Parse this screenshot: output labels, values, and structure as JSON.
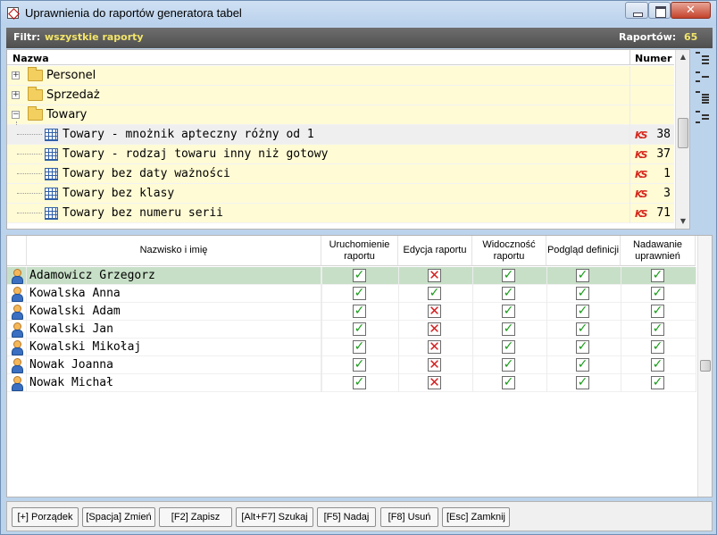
{
  "window": {
    "title": "Uprawnienia do raportów generatora tabel",
    "close_glyph": "✕"
  },
  "filter": {
    "label": "Filtr:",
    "value": "wszystkie raporty",
    "count_label": "Raportów:",
    "count_value": "65"
  },
  "reports": {
    "col_name": "Nazwa",
    "col_number": "Numer",
    "folders": [
      {
        "label": "Personel",
        "expander": "+"
      },
      {
        "label": "Sprzedaż",
        "expander": "+"
      },
      {
        "label": "Towary",
        "expander": "−"
      }
    ],
    "items": [
      {
        "label": "Towary - mnożnik apteczny różny od 1",
        "number": "38",
        "icon_text": "KS"
      },
      {
        "label": "Towary - rodzaj towaru inny niż gotowy",
        "number": "37",
        "icon_text": "KS"
      },
      {
        "label": "Towary bez daty ważności",
        "number": "1",
        "icon_text": "KS"
      },
      {
        "label": "Towary bez klasy",
        "number": "3",
        "icon_text": "KS"
      },
      {
        "label": "Towary bez numeru serii",
        "number": "71",
        "icon_text": "KS"
      }
    ],
    "scroll_up": "▲",
    "scroll_down": "▼"
  },
  "permissions": {
    "columns": [
      "Nazwisko i imię",
      "Uruchomienie raportu",
      "Edycja raportu",
      "Widoczność raportu",
      "Podgląd definicji",
      "Nadawanie uprawnień"
    ],
    "check_yes": "✓",
    "check_no": "✕",
    "users": [
      {
        "name": "Adamowicz Grzegorz",
        "flags": [
          true,
          false,
          true,
          true,
          true
        ]
      },
      {
        "name": "Kowalska Anna",
        "flags": [
          true,
          true,
          true,
          true,
          true
        ]
      },
      {
        "name": "Kowalski Adam",
        "flags": [
          true,
          false,
          true,
          true,
          true
        ]
      },
      {
        "name": "Kowalski Jan",
        "flags": [
          true,
          false,
          true,
          true,
          true
        ]
      },
      {
        "name": "Kowalski Mikołaj",
        "flags": [
          true,
          false,
          true,
          true,
          true
        ]
      },
      {
        "name": "Nowak Joanna",
        "flags": [
          true,
          false,
          true,
          true,
          true
        ]
      },
      {
        "name": "Nowak Michał",
        "flags": [
          true,
          false,
          true,
          true,
          true
        ]
      }
    ]
  },
  "buttons": [
    "[+] Porządek",
    "[Spacja] Zmień",
    "[F2] Zapisz",
    "[Alt+F7] Szukaj",
    "[F5] Nadaj",
    "[F8] Usuń",
    "[Esc] Zamknij"
  ],
  "colors": {
    "folder_bg": "#fffbd5",
    "selected_user_bg": "#c7dfc7",
    "filter_value": "#f3e56a",
    "check_yes": "#1a9b1a",
    "check_no": "#d42020"
  }
}
